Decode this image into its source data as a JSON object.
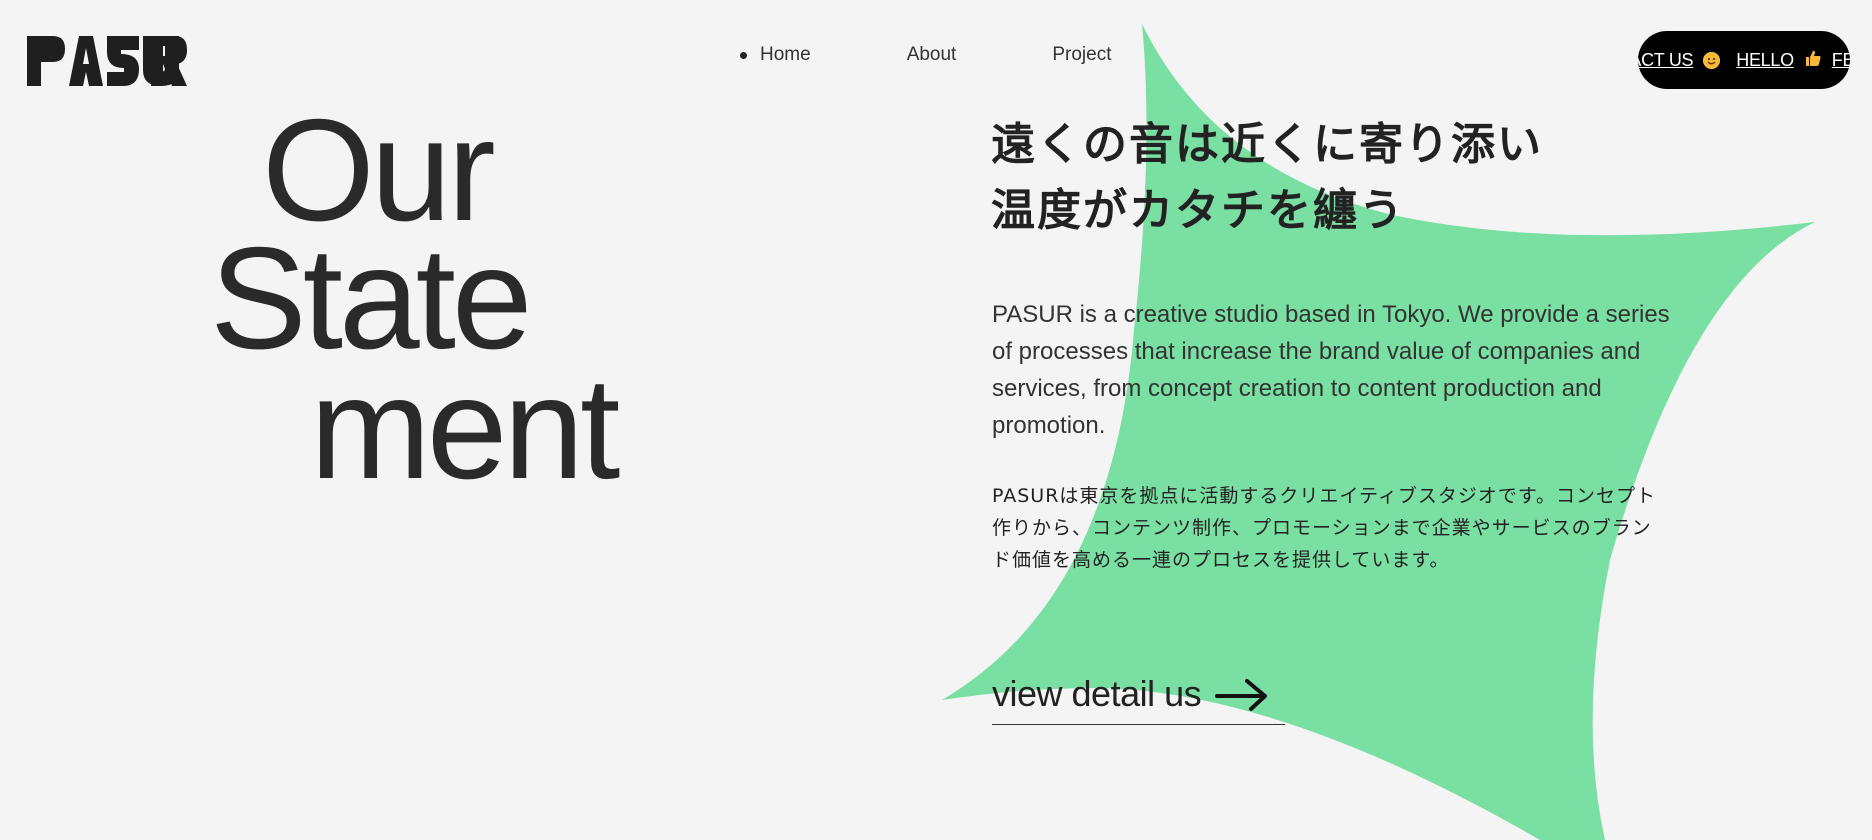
{
  "header": {
    "nav": [
      {
        "label": "Home",
        "active": true
      },
      {
        "label": "About",
        "active": false
      },
      {
        "label": "Project",
        "active": false
      }
    ],
    "ticker": {
      "text1": "TACT US",
      "text2": "HELLO",
      "text3": "FEE"
    }
  },
  "hero": {
    "line1": "Our",
    "line2": "State",
    "line3": "ment"
  },
  "statement": {
    "jp_title_1": "遠くの音は近くに寄り添い",
    "jp_title_2": "温度がカタチを纏う",
    "en_description": "PASUR is a creative studio based in Tokyo. We provide a series of processes that increase the brand value of companies and services, from concept creation to content production and promotion.",
    "jp_description": "PASURは東京を拠点に活動するクリエイティブスタジオです。コンセプト作りから、コンテンツ制作、プロモーションまで企業やサービスのブランド価値を高める一連のプロセスを提供しています。",
    "cta": "view detail us"
  },
  "colors": {
    "background": "#f4f4f4",
    "accent_shape": "#7adfa2",
    "text": "#222222",
    "pill": "#000000"
  },
  "icons": [
    "logo",
    "smile-emoji-icon",
    "thumbs-up-icon",
    "arrow-right-icon",
    "nav-active-dot-icon"
  ]
}
